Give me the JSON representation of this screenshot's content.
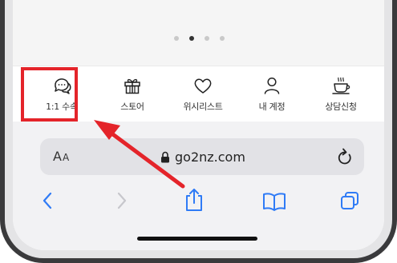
{
  "pager": {
    "count": 4,
    "active_index": 1
  },
  "tabs": [
    {
      "label": "1:1 수속",
      "icon": "chat-bubbles-icon"
    },
    {
      "label": "스토어",
      "icon": "gift-icon"
    },
    {
      "label": "위시리스트",
      "icon": "heart-icon"
    },
    {
      "label": "내 계정",
      "icon": "person-icon"
    },
    {
      "label": "상담신청",
      "icon": "coffee-cup-icon"
    }
  ],
  "browser": {
    "text_size_label": "A",
    "text_size_label_small": "A",
    "url": "go2nz.com"
  },
  "colors": {
    "accent": "#2f7bf6",
    "highlight": "#e4242a",
    "disabled": "#c7c7cc"
  }
}
